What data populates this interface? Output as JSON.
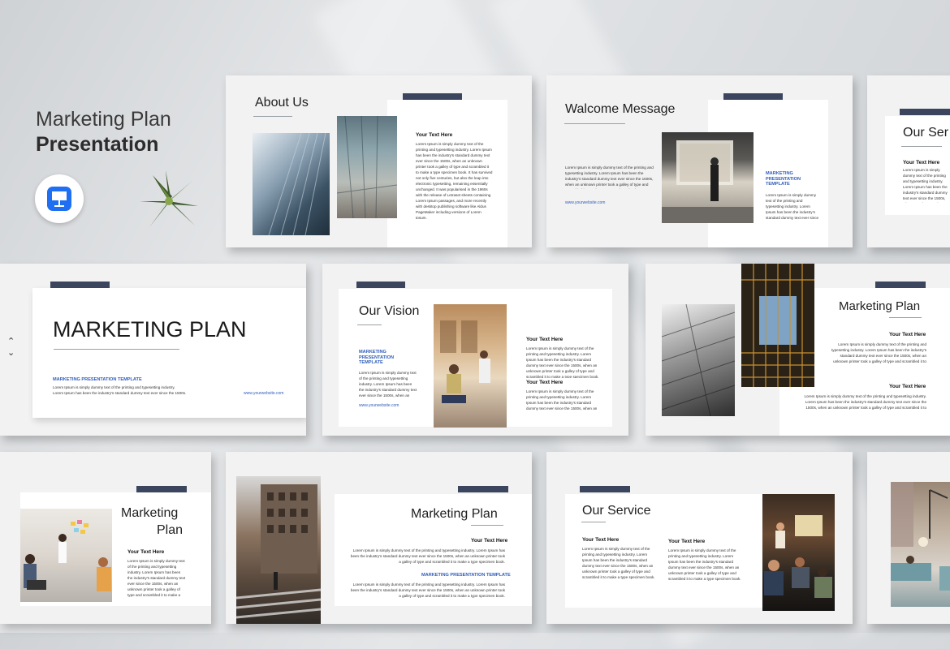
{
  "hero": {
    "title_line1": "Marketing Plan",
    "title_line2": "Presentation"
  },
  "filler": "Lorem Ipsum is simply dummy text of the printing and typesetting industry. Lorem Ipsum has been the industry's standard dummy text ever since the 1500s, when an unknown printer took a galley of type and scrambled it to make a type specimen book.",
  "filler_long": "Lorem Ipsum is simply dummy text of the printing and typesetting industry. Lorem Ipsum has been the industry's standard dummy text ever since the 1500s, when an unknown printer took a galley of type and scrambled it to make a type specimen book. It has survived not only five centuries, but also the leap into electronic typesetting, remaining essentially unchanged. It was popularised in the 1960s with the release of Letraset sheets containing Lorem Ipsum passages, and more recently with desktop publishing software like Aldus PageMaker including versions of Lorem Ipsum.",
  "your_text": "Your Text Here",
  "url": "www.yourwebsite.com",
  "template_label": "MARKETING PRESENTATION TEMPLATE",
  "slides": {
    "about": {
      "title": "About Us"
    },
    "welcome": {
      "title": "Walcome Message"
    },
    "services": {
      "title": "Our Ser"
    },
    "cover": {
      "title": "MARKETING PLAN",
      "line1": "Lorem Ipsum is simply dummy text of the printing and typesetting industry.",
      "line2": "Lorem Ipsum has been the industry's standard dummy text ever since the 1500s."
    },
    "vision": {
      "title": "Our Vision"
    },
    "plan_right": {
      "title": "Marketing Plan"
    },
    "plan_left": {
      "title1": "Marketing",
      "title2": "Plan"
    },
    "plan_mid": {
      "title": "Marketing Plan"
    },
    "service": {
      "title": "Our Service"
    }
  },
  "nav": {
    "up": "⌃",
    "down": "⌄"
  },
  "colors": {
    "accent_bar": "#3b465e",
    "blue_text": "#2f5dbb",
    "keynote_blue": "#1e6ff2"
  }
}
